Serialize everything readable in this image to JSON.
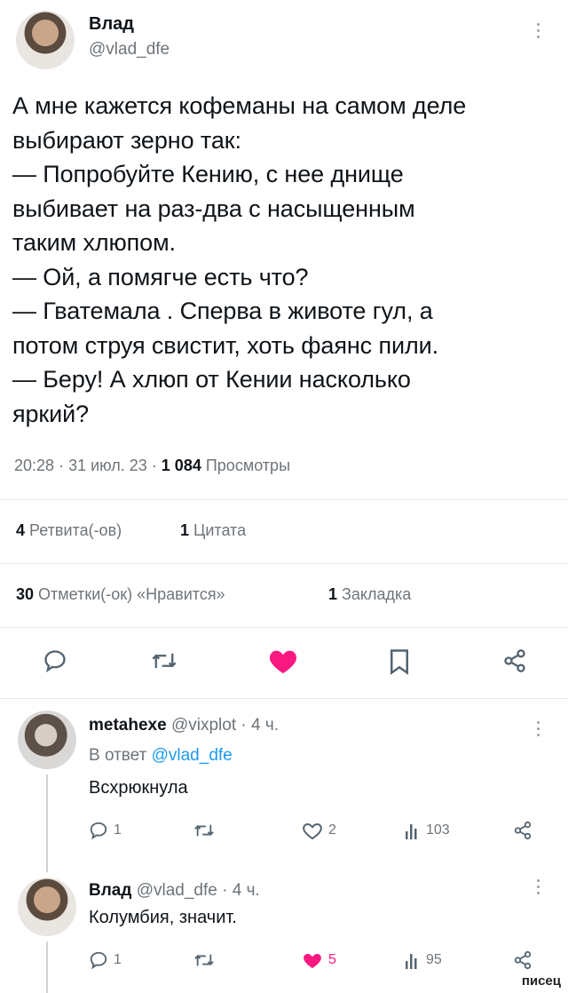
{
  "post": {
    "author_name": "Влад",
    "author_handle": "@vlad_dfe",
    "text": "А мне кажется кофеманы на самом деле\nвыбирают зерно так:\n— Попробуйте Кению, с нее днище\nвыбивает на раз-два с насыщенным\nтаким хлюпом.\n— Ой, а помягче есть что?\n— Гватемала . Сперва в животе гул, а\nпотом струя свистит, хоть фаянс пили.\n— Беру! А хлюп от Кении насколько\nяркий?",
    "time": "20:28",
    "date": "31 июл. 23",
    "views_count": "1 084",
    "views_label": "Просмотры",
    "retweets_count": "4",
    "retweets_label": "Ретвита(-ов)",
    "quotes_count": "1",
    "quotes_label": "Цитата",
    "likes_count": "30",
    "likes_label": "Отметки(-ок) «Нравится»",
    "bookmarks_count": "1",
    "bookmarks_label": "Закладка",
    "liked": true
  },
  "replies": [
    {
      "author_name": "metahexe",
      "author_handle": "@vixplot",
      "age": "4 ч.",
      "in_reply_prefix": "В ответ",
      "in_reply_handle": "@vlad_dfe",
      "text": "Всхрюкнула",
      "comments": "1",
      "retweets": "",
      "likes": "2",
      "views": "103",
      "liked": false
    },
    {
      "author_name": "Влад",
      "author_handle": "@vlad_dfe",
      "age": "4 ч.",
      "text": "Колумбия, значит.",
      "comments": "1",
      "retweets": "",
      "likes": "5",
      "views": "95",
      "liked": true
    }
  ],
  "watermark": "писец",
  "colors": {
    "like_pink": "#f91880",
    "link_blue": "#1d9bf0",
    "text": "#0f1419",
    "muted": "#6e7479"
  },
  "icons": [
    "reply-icon",
    "retweet-icon",
    "heart-icon",
    "bookmark-icon",
    "share-icon",
    "views-icon",
    "more-icon"
  ]
}
